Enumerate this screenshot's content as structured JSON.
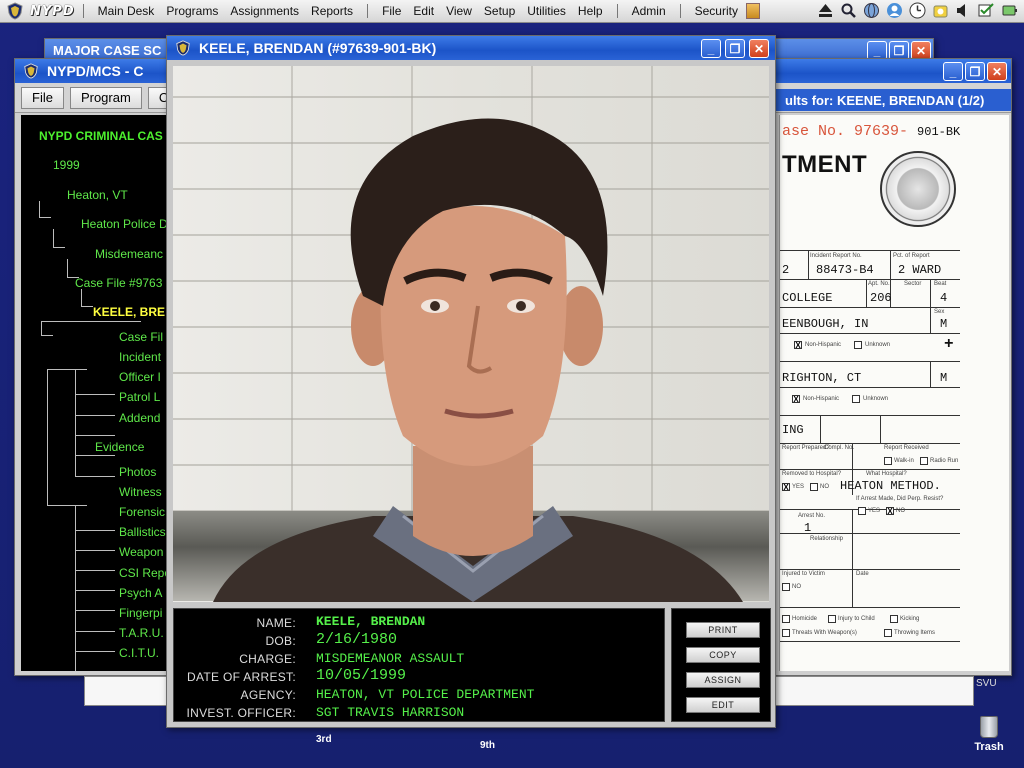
{
  "menubar": {
    "brand": "NYPD",
    "items": [
      "Main Desk",
      "Programs",
      "Assignments",
      "Reports",
      "File",
      "Edit",
      "View",
      "Setup",
      "Utilities",
      "Help",
      "Admin",
      "Security"
    ]
  },
  "windows": {
    "major_case": {
      "title": "MAJOR CASE SC"
    },
    "mcs": {
      "title": "NYPD/MCS - C",
      "toolbar": [
        "File",
        "Program",
        "Cr"
      ],
      "results_header": "ults for:  KEENE, BRENDAN (1/2)"
    },
    "mugshot": {
      "title": "KEELE, BRENDAN (#97639-901-BK)"
    }
  },
  "tree": {
    "root": "NYPD CRIMINAL CAS",
    "year": "1999",
    "city": "Heaton, VT",
    "dept": "Heaton Police D",
    "misdemeanor": "Misdemeanc",
    "case_file": "Case File #9763",
    "person": "KEELE, BRE",
    "person_children": [
      "Case Fil",
      "Incident",
      "Officer I",
      "Patrol L",
      "Addend"
    ],
    "evidence": "Evidence",
    "evidence_children": [
      "Photos",
      "Witness",
      "Forensic",
      "Ballistics",
      "Weapon",
      "CSI Repo",
      "Psych A",
      "Fingerpi",
      "T.A.R.U.",
      "C.I.T.U."
    ]
  },
  "report": {
    "case_no_label": "ase No. 97639-",
    "case_no_suffix": "901-BK",
    "dept_heading": "TMENT",
    "incident_report_no_label": "Incident Report No.",
    "incident_report_no": "88473-B4",
    "pct_label": "Pct. of Report",
    "pct": "2 WARD",
    "row1_left": "2",
    "location": "COLLEGE",
    "apt_label": "Apt. No.",
    "apt": "206",
    "sector_label": "Sector",
    "beat_label": "Beat",
    "beat": "4",
    "place1": "EENBOUGH, IN",
    "sex_label": "Sex",
    "sex1": "M",
    "non_hispanic": "Non-Hispanic",
    "unknown": "Unknown",
    "place2": "RIGHTON, CT",
    "sex2": "M",
    "ing": "ING",
    "report_prepared": "Report Prepared?",
    "compl_no": "Compl. No.",
    "report_received": "Report Received",
    "walk_in": "Walk-in",
    "radio_run": "Radio Run",
    "removed_hospital": "Removed to Hospital?",
    "what_hospital": "What Hospital?",
    "yes": "YES",
    "no": "NO",
    "hospital": "HEATON METHOD.",
    "arrest_made": "If Arrest Made, Did Perp. Resist?",
    "arrest_no_label": "Arrest No.",
    "arrest_no": "1",
    "relationship": "Relationship",
    "injured_victim": "Injured to Victim",
    "date_label": "Date",
    "homicide": "Homicide",
    "injury_child": "Injury to Child",
    "kicking": "Kicking",
    "threats": "Threats With Weapon(s)",
    "throwing": "Throwing Items"
  },
  "suspect": {
    "labels": [
      "NAME:",
      "DOB:",
      "CHARGE:",
      "DATE OF ARREST:",
      "AGENCY:",
      "INVEST. OFFICER:"
    ],
    "name": "KEELE, BRENDAN",
    "dob": "2/16/1980",
    "charge": "MISDEMEANOR ASSAULT",
    "date_of_arrest": "10/05/1999",
    "agency": "HEATON, VT POLICE DEPARTMENT",
    "invest_officer": "SGT TRAVIS HARRISON"
  },
  "actions": [
    "PRINT",
    "COPY",
    "ASSIGN",
    "EDIT"
  ],
  "dock": {
    "label_3rd": "3rd",
    "label_9th": "9th",
    "label_svu": "SVU",
    "trash": "Trash"
  },
  "colors": {
    "accent_blue": "#1c54c8",
    "terminal_green": "#55f04a",
    "highlight_yellow": "#ffff40",
    "desktop": "#19216f"
  }
}
